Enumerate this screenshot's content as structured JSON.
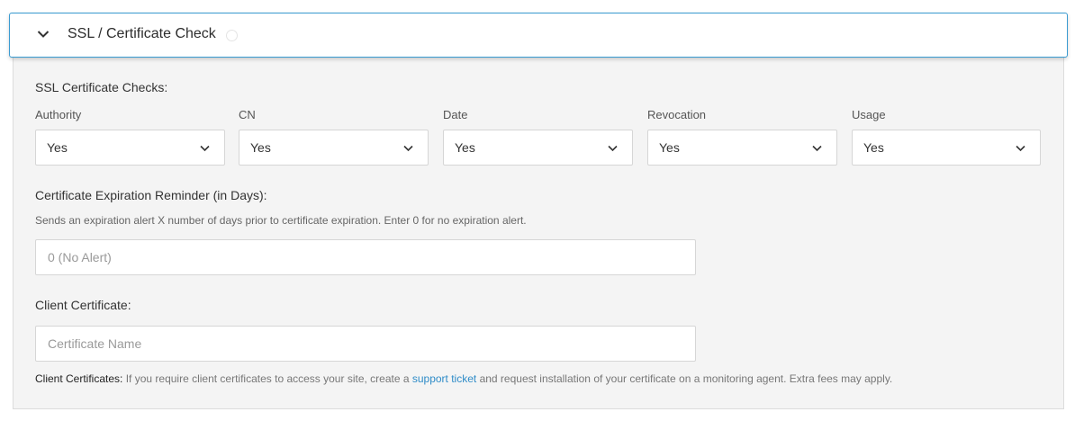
{
  "section": {
    "title": "SSL / Certificate Check"
  },
  "ssl_checks": {
    "heading": "SSL Certificate Checks:",
    "fields": [
      {
        "label": "Authority",
        "value": "Yes"
      },
      {
        "label": "CN",
        "value": "Yes"
      },
      {
        "label": "Date",
        "value": "Yes"
      },
      {
        "label": "Revocation",
        "value": "Yes"
      },
      {
        "label": "Usage",
        "value": "Yes"
      }
    ]
  },
  "expiration": {
    "heading": "Certificate Expiration Reminder (in Days):",
    "help": "Sends an expiration alert X number of days prior to certificate expiration. Enter 0 for no expiration alert.",
    "value": "",
    "placeholder": "0 (No Alert)"
  },
  "client_cert": {
    "heading": "Client Certificate:",
    "value": "",
    "placeholder": "Certificate Name",
    "note_lead": "Client Certificates:",
    "note_before": " If you require client certificates to access your site, create a ",
    "note_link": "support ticket",
    "note_after": " and request installation of your certificate on a monitoring agent. Extra fees may apply."
  },
  "icons": {
    "collapse": "chevron-down-icon",
    "info": "info-icon",
    "dropdown": "chevron-down-icon"
  },
  "colors": {
    "accent": "#3a9bd1",
    "link": "#2f8cc8",
    "panel_bg": "#f4f4f4"
  }
}
